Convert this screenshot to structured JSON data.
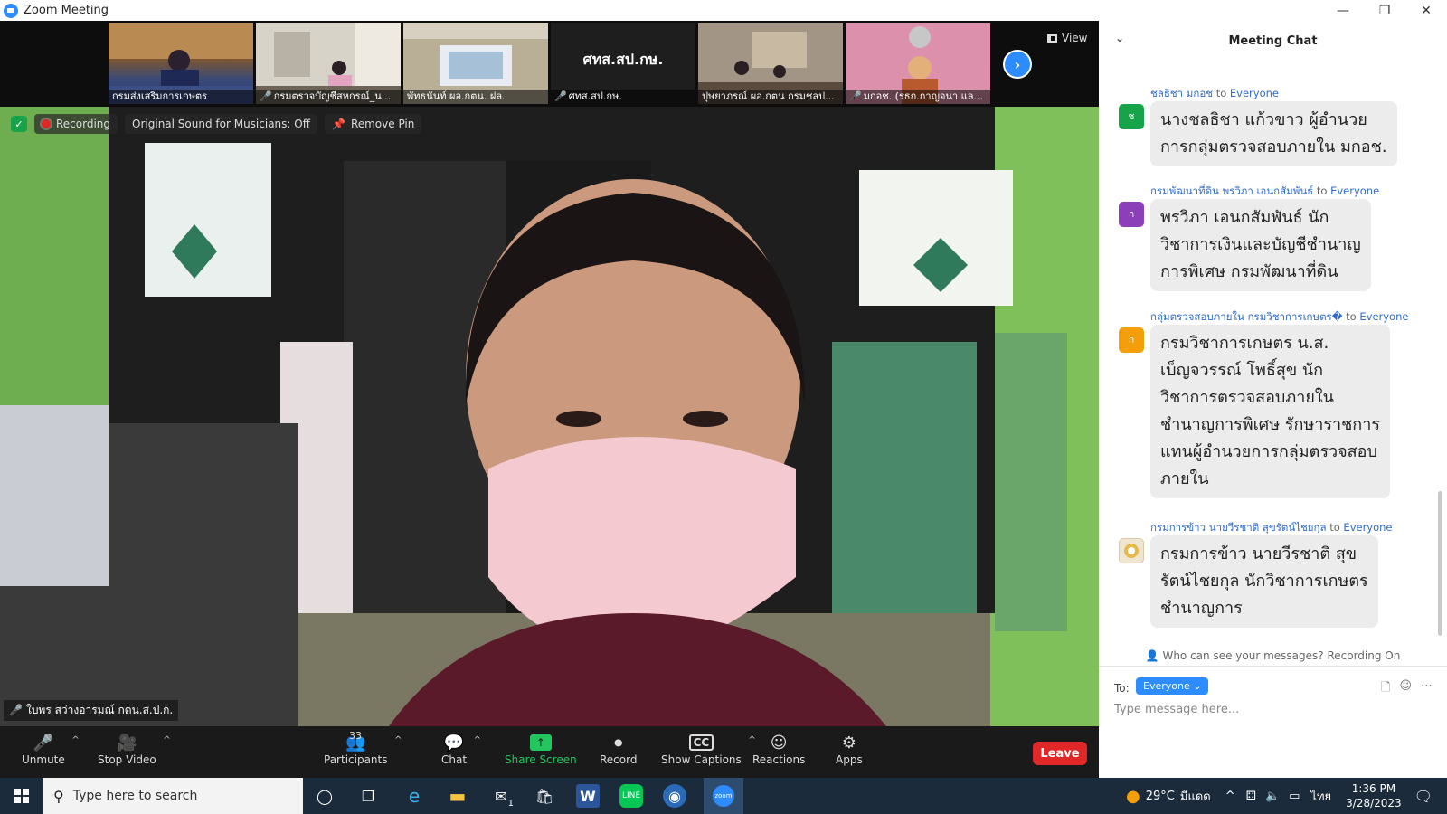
{
  "window": {
    "title": "Zoom Meeting",
    "minimize": "—",
    "restore": "❐",
    "close": "✕"
  },
  "strip": {
    "thumbnails": [
      {
        "label": "กรมส่งเสริมการเกษตร",
        "muted": false
      },
      {
        "label": "กรมตรวจบัญชีสหกรณ์_น...",
        "muted": true
      },
      {
        "label": "พัทธนันท์ ผอ.กตน. ฝล.",
        "muted": false
      },
      {
        "label": "ศทส.สป.กษ.",
        "muted": true,
        "text_tile": "ศทส.สป.กษ."
      },
      {
        "label": "ปุษยาภรณ์ ผอ.กตน กรมชลป...",
        "muted": false
      },
      {
        "label": "มกอช. (รธก.กาญจนา แล...",
        "muted": true
      }
    ],
    "view_label": "View",
    "next_arrow": "›"
  },
  "main": {
    "recording_label": "Recording",
    "original_sound": "Original Sound for Musicians: Off",
    "remove_pin": "Remove Pin",
    "speaker_name": "ใบพร สว่างอารมณ์ กตน.ส.ป.ก."
  },
  "toolbar": {
    "unmute": "Unmute",
    "stop_video": "Stop Video",
    "participants": "Participants",
    "participant_count": "33",
    "chat": "Chat",
    "share_screen": "Share Screen",
    "record": "Record",
    "show_captions": "Show Captions",
    "reactions": "Reactions",
    "apps": "Apps",
    "leave": "Leave"
  },
  "chat": {
    "title": "Meeting Chat",
    "to_word": "to",
    "messages": [
      {
        "sender": "ชลธิชา มกอช",
        "recipient": "Everyone",
        "avatar": "ช",
        "avatar_color": "#16a34a",
        "lines": [
          "นางชลธิชา แก้วขาว ผู้อำนวย",
          "การกลุ่มตรวจสอบภายใน มกอช."
        ]
      },
      {
        "sender": "กรมพัฒนาที่ดิน พรวิภา เอนกสัมพันธ์",
        "recipient": "Everyone",
        "avatar": "ก",
        "avatar_color": "#8b3fb8",
        "lines": [
          "พรวิภา เอนกสัมพันธ์ นัก",
          "วิชาการเงินและบัญชีชำนาญ",
          "การพิเศษ กรมพัฒนาที่ดิน"
        ]
      },
      {
        "sender": "กลุ่มตรวจสอบภายใน กรมวิชาการเกษตร�",
        "recipient": "Everyone",
        "avatar": "ก",
        "avatar_color": "#f59e0b",
        "lines": [
          "กรมวิชาการเกษตร น.ส.",
          "เบ็ญจวรรณ์ โพธิ์สุข นัก",
          "วิชาการตรวจสอบภายใน",
          "ชำนาญการพิเศษ รักษาราชการ",
          "แทนผู้อำนวยการกลุ่มตรวจสอบ",
          "ภายใน"
        ]
      },
      {
        "sender": "กรมการข้าว  นายวีรชาติ   สุขรัตน์ไชยกุล",
        "recipient": "Everyone",
        "avatar": "",
        "avatar_color": "#d9c9a8",
        "lines": [
          "กรมการข้าว นายวีรชาติ สุข",
          "รัตน์ไชยกุล นักวิชาการเกษตร",
          "ชำนาญการ"
        ]
      }
    ],
    "who_can_see": "Who can see your messages? Recording On",
    "to_label": "To:",
    "to_value": "Everyone",
    "input_placeholder": "Type message here..."
  },
  "taskbar": {
    "search_placeholder": "Type here to search",
    "weather": "29°C",
    "weather_place": "มีแดด",
    "language": "ไทย",
    "time": "1:36 PM",
    "date": "3/28/2023",
    "mail_badge": "1"
  }
}
